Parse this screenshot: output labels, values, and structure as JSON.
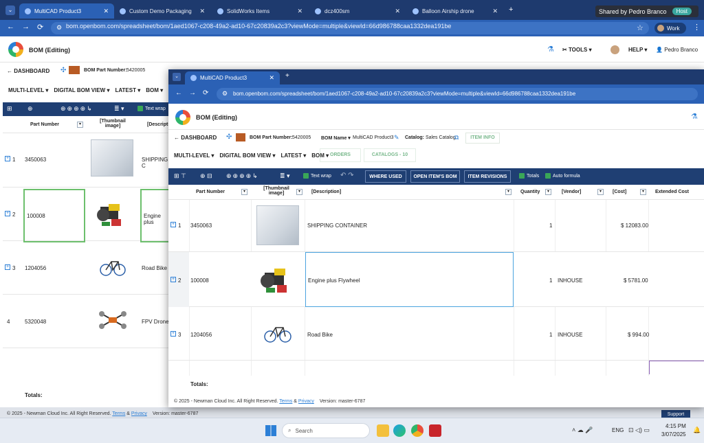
{
  "browser": {
    "tabs": [
      {
        "label": "MultiCAD Product3",
        "active": true
      },
      {
        "label": "Custom Demo Packaging"
      },
      {
        "label": "SolidWorks Items"
      },
      {
        "label": "dcz400sm"
      },
      {
        "label": "Balloon Airship drone"
      }
    ],
    "new_tab": "+",
    "shared_by": "Shared by Pedro Branco",
    "host_badge": "Host",
    "url": "bom.openbom.com/spreadsheet/bom/1aed1067-c208-49a2-ad10-67c20839a2c3?viewMode=multiple&viewId=66d986788caa1332dea191be",
    "profile": "Work"
  },
  "app": {
    "title": "BOM (Editing)",
    "tools": "TOOLS",
    "help": "HELP",
    "user": "Pedro Branco",
    "dashboard": "DASHBOARD",
    "bom_part_number_label": "BOM Part Number:",
    "bom_part_number": "5420005",
    "bom_name_label": "BOM Name",
    "bom_name": "MultiCAD Product3",
    "catalog_label": "Catalog:",
    "catalog": "Sales Catalog",
    "item_info": "ITEM INFO",
    "nav": [
      "MULTI-LEVEL",
      "DIGITAL BOM VIEW",
      "LATEST",
      "BOM"
    ],
    "orders": "ORDERS",
    "catalogs": "CATALOGS - 10",
    "text_wrap": "Text wrap",
    "where_used": "WHERE USED",
    "open_items_bom": "OPEN ITEM'S BOM",
    "item_revisions": "ITEM REVISIONS",
    "totals_chk": "Totals",
    "auto_formula": "Auto formula",
    "columns": {
      "part_number": "Part Number",
      "thumbnail": "[Thumbnail image]",
      "description": "[Description]",
      "description_short": "[Descripti",
      "quantity": "Quantity",
      "vendor": "[Vendor]",
      "cost": "[Cost]",
      "extended_cost": "Extended Cost"
    },
    "rows": [
      {
        "idx": "1",
        "part": "3450063",
        "desc": "SHIPPING CONTAINER",
        "desc_back": "SHIPPING C",
        "qty": "1",
        "vendor": "",
        "cost": "$ 12083.00"
      },
      {
        "idx": "2",
        "part": "100008",
        "desc": "Engine plus Flywheel",
        "desc_back": "Engine plus",
        "qty": "1",
        "vendor": "INHOUSE",
        "cost": "$ 5781.00"
      },
      {
        "idx": "3",
        "part": "1204056",
        "desc": "Road Bike",
        "desc_back": "Road Bike",
        "qty": "1",
        "vendor": "INHOUSE",
        "cost": "$ 994.00"
      },
      {
        "idx": "4",
        "part": "5320048",
        "desc": "",
        "desc_back": "FPV Drone",
        "qty": "",
        "vendor": "",
        "cost": ""
      }
    ],
    "totals": "Totals:",
    "footer_copy": "© 2025 - Newman Cloud Inc. All Right Reserved.",
    "terms": "Terms",
    "amp": "&",
    "privacy": "Privacy",
    "version": "Version: master-6787",
    "support": "Support"
  },
  "front_window": {
    "tab_label": "MultiCAD Product3",
    "url": "bom.openbom.com/spreadsheet/bom/1aed1067-c208-49a2-ad10-67c20839a2c3?viewMode=multiple&viewId=66d986788caa1332dea191be"
  },
  "taskbar": {
    "search": "Search",
    "lang": "ENG",
    "time": "4:15 PM",
    "date": "3/07/2025"
  }
}
